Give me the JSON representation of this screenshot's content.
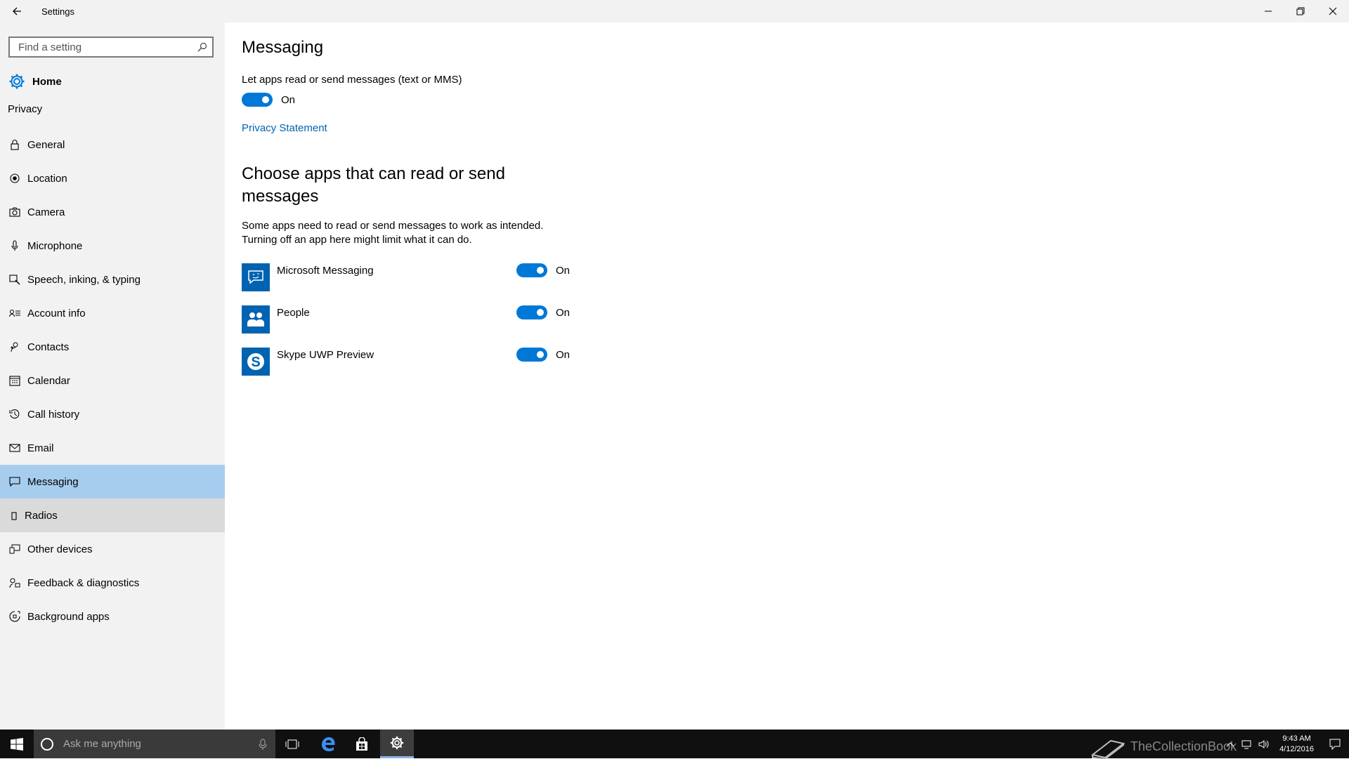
{
  "window": {
    "title": "Settings",
    "back_icon": "back-arrow-icon",
    "controls": [
      "minimize-icon",
      "restore-icon",
      "close-icon"
    ]
  },
  "sidebar": {
    "search_placeholder": "Find a setting",
    "home_label": "Home",
    "section": "Privacy",
    "items": [
      {
        "label": "General",
        "icon": "lock-icon"
      },
      {
        "label": "Location",
        "icon": "location-icon"
      },
      {
        "label": "Camera",
        "icon": "camera-icon"
      },
      {
        "label": "Microphone",
        "icon": "microphone-icon"
      },
      {
        "label": "Speech, inking, & typing",
        "icon": "speech-icon"
      },
      {
        "label": "Account info",
        "icon": "account-info-icon"
      },
      {
        "label": "Contacts",
        "icon": "contacts-icon"
      },
      {
        "label": "Calendar",
        "icon": "calendar-icon"
      },
      {
        "label": "Call history",
        "icon": "history-icon"
      },
      {
        "label": "Email",
        "icon": "email-icon"
      },
      {
        "label": "Messaging",
        "icon": "message-icon",
        "selected": true
      },
      {
        "label": "Radios",
        "icon": "radio-icon",
        "hover": true
      },
      {
        "label": "Other devices",
        "icon": "devices-icon"
      },
      {
        "label": "Feedback & diagnostics",
        "icon": "feedback-icon"
      },
      {
        "label": "Background apps",
        "icon": "background-apps-icon"
      }
    ]
  },
  "main": {
    "title": "Messaging",
    "main_setting": {
      "label": "Let apps read or send messages (text or MMS)",
      "state": "On"
    },
    "privacy_link": "Privacy Statement",
    "apps_heading": "Choose apps that can read or send messages",
    "apps_description_1": "Some apps need to read or send messages to work as intended.",
    "apps_description_2": "Turning off an app here might limit what it can do.",
    "apps": [
      {
        "name": "Microsoft Messaging",
        "state": "On",
        "icon": "messaging-app-icon"
      },
      {
        "name": "People",
        "state": "On",
        "icon": "people-app-icon"
      },
      {
        "name": "Skype UWP Preview",
        "state": "On",
        "icon": "skype-app-icon"
      }
    ]
  },
  "taskbar": {
    "search_placeholder": "Ask me anything",
    "time": "9:43 AM",
    "date": "4/12/2016",
    "watermark": "TheCollectionBook"
  },
  "colors": {
    "accent": "#0078d7",
    "selected_nav": "#a6cdee",
    "sidebar_bg": "#f2f2f2",
    "link": "#0063b1",
    "taskbar": "#101010"
  }
}
